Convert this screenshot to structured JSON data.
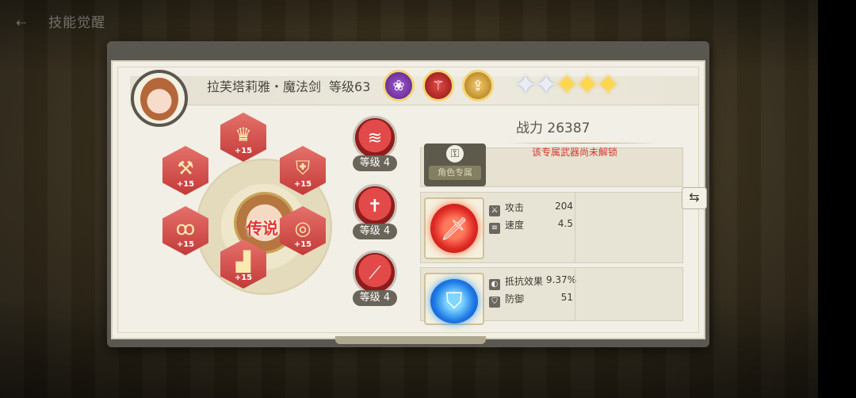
{
  "header": {
    "character_name": "拉芙塔莉雅・魔法剑",
    "level_label": "等级63",
    "skill_icons": [
      "purple-lotus-icon",
      "red-trident-icon",
      "gold-upgrade-icon"
    ],
    "stars": [
      {
        "type": "silver"
      },
      {
        "type": "silver"
      },
      {
        "type": "gold"
      },
      {
        "type": "gold"
      },
      {
        "type": "gold"
      }
    ]
  },
  "equipment": {
    "center_label": "传说",
    "slots": [
      {
        "name": "equip-helmet",
        "glyph": "♛",
        "plus": "+15"
      },
      {
        "name": "equip-hammer",
        "glyph": "⚒",
        "plus": "+15"
      },
      {
        "name": "equip-armor",
        "glyph": "⛨",
        "plus": "+15"
      },
      {
        "name": "equip-necklace",
        "glyph": "ꝏ",
        "plus": "+15"
      },
      {
        "name": "equip-ring",
        "glyph": "◎",
        "plus": "+15"
      },
      {
        "name": "equip-boots",
        "glyph": "▟",
        "plus": "+15"
      }
    ]
  },
  "upgrades": [
    {
      "label": "等级 4",
      "icon": "triple-slash-icon"
    },
    {
      "label": "等级 4",
      "icon": "sword-icon"
    },
    {
      "label": "等级 4",
      "icon": "slash-icon"
    }
  ],
  "power": {
    "label": "战力 26387"
  },
  "exclusive_weapon": {
    "tag": "角色专属",
    "message": "该专属武器尚未解锁"
  },
  "items": [
    {
      "icon": "sword-icon",
      "stats": [
        {
          "icon": "attack-icon",
          "label": "攻击",
          "value": "204"
        },
        {
          "icon": "speed-icon",
          "label": "速度",
          "value": "4.5"
        }
      ]
    },
    {
      "icon": "shield-icon",
      "stats": [
        {
          "icon": "resist-icon",
          "label": "抵抗效果",
          "value": "9.37%"
        },
        {
          "icon": "defense-icon",
          "label": "防御",
          "value": "51"
        }
      ]
    }
  ],
  "swap_button": {
    "glyph": "⇆"
  },
  "background": {
    "title": "技能觉醒"
  }
}
